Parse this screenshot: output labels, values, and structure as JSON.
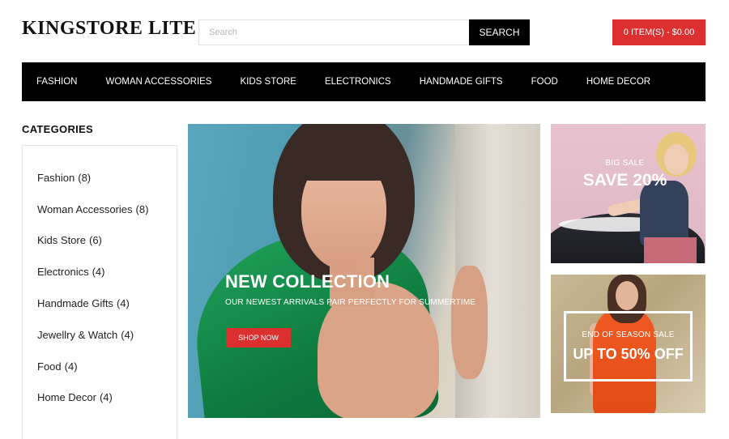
{
  "header": {
    "logo": "KINGSTORE LITE",
    "search_placeholder": "Search",
    "search_button": "SEARCH",
    "cart_label": "0 ITEM(S) - $0.00"
  },
  "nav": {
    "items": [
      "FASHION",
      "WOMAN ACCESSORIES",
      "KIDS STORE",
      "ELECTRONICS",
      "HANDMADE GIFTS",
      "FOOD",
      "HOME DECOR"
    ]
  },
  "sidebar": {
    "title": "CATEGORIES",
    "items": [
      {
        "label": "Fashion",
        "count": "(8)"
      },
      {
        "label": "Woman Accessories",
        "count": "(8)"
      },
      {
        "label": "Kids Store",
        "count": "(6)"
      },
      {
        "label": "Electronics",
        "count": "(4)"
      },
      {
        "label": "Handmade Gifts",
        "count": "(4)"
      },
      {
        "label": "Jewellry & Watch",
        "count": "(4)"
      },
      {
        "label": "Food",
        "count": "(4)"
      },
      {
        "label": "Home Decor",
        "count": "(4)"
      }
    ]
  },
  "hero": {
    "headline": "NEW COLLECTION",
    "subtitle": "OUR NEWEST ARRIVALS PAIR PERFECTLY FOR SUMMERTIME",
    "button": "SHOP NOW"
  },
  "promo_1": {
    "kicker": "BIG SALE",
    "headline": "SAVE 20%"
  },
  "promo_2": {
    "kicker": "END OF SEASON SALE",
    "headline": "UP TO 50% OFF"
  },
  "colors": {
    "accent": "#dc2f2f",
    "nav_bg": "#000000"
  }
}
